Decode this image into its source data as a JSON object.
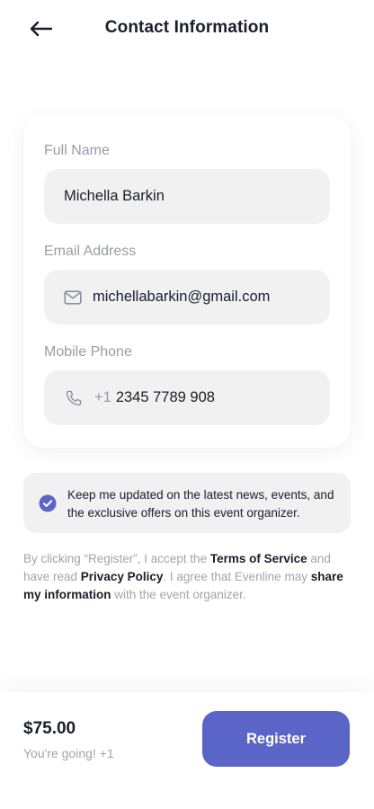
{
  "header": {
    "title": "Contact Information",
    "back_icon": "arrow-left-icon"
  },
  "form": {
    "full_name": {
      "label": "Full Name",
      "value": "Michella Barkin"
    },
    "email": {
      "label": "Email Address",
      "value": "michellabarkin@gmail.com",
      "icon": "mail-icon"
    },
    "phone": {
      "label": "Mobile Phone",
      "prefix": "+1",
      "value": "2345 7789 908",
      "icon": "phone-icon"
    }
  },
  "consent": {
    "checked": true,
    "text": "Keep me updated on the latest news, events, and the exclusive offers on this event organizer."
  },
  "legal": {
    "part1": "By clicking “Register”, I accept the ",
    "terms": "Terms of Service",
    "part2": " and have read ",
    "privacy": "Privacy Policy",
    "part3": ". I agree that Evenline may ",
    "share": "share my information",
    "part4": " with the event organizer."
  },
  "footer": {
    "price": "$75.00",
    "going": "You're going! +1",
    "register_label": "Register"
  },
  "colors": {
    "accent": "#5b65c8",
    "field_bg": "#f1f1f1",
    "muted_text": "#9a9ca6",
    "dark_text": "#1b1d2a"
  }
}
